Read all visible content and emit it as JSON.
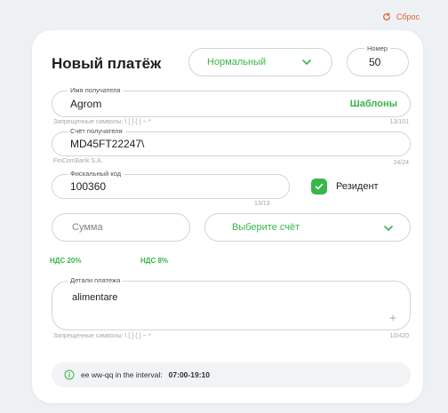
{
  "reset": {
    "label": "Сброс"
  },
  "header": {
    "title": "Новый платёж",
    "priority_value": "Нормальный",
    "number_label": "Номер",
    "number_value": "50"
  },
  "recipient": {
    "label": "Имя получателя",
    "value": "Agrom",
    "templates_label": "Шаблоны",
    "hint": "Запрещенные символы: \\ [ ] { } ~ *",
    "counter": "13/101"
  },
  "account": {
    "label": "Счёт получателя",
    "value": "MD45FT22247\\",
    "bank_hint": "FinComBank S.A.",
    "counter": "24/24"
  },
  "fiscal": {
    "label": "Фискальный код",
    "value": "100360",
    "counter": "13/13",
    "resident_label": "Резидент"
  },
  "amount": {
    "placeholder": "Сумма"
  },
  "account_select": {
    "value": "Выберите счёт"
  },
  "vat": {
    "vat20": "НДС 20%",
    "vat8": "НДС 8%"
  },
  "details": {
    "label": "Детали платежа",
    "value": "alimentare",
    "hint": "Запрещенные символы: \\ [ ] { } ~ *",
    "counter": "10/420"
  },
  "info": {
    "text": "ee ww-qq in the interval:",
    "time": "07:00-19:10"
  },
  "colors": {
    "accent_green": "#39b54a",
    "reset_orange": "#e0603a"
  }
}
